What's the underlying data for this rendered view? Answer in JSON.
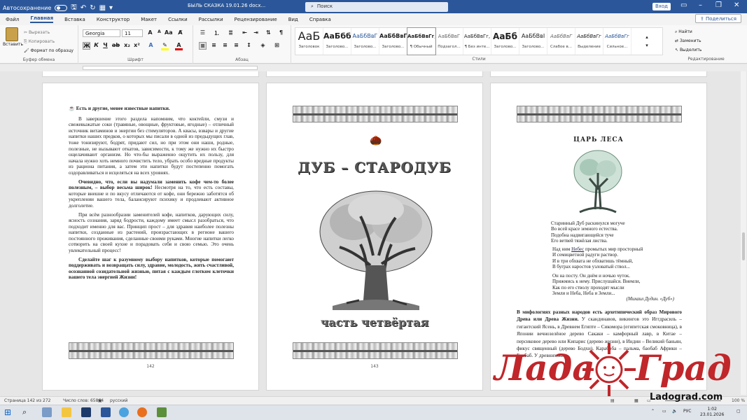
{
  "titlebar": {
    "autosave": "Автосохранение",
    "doc_title": "БЫЛЬ СКАЗКА 19.01.26 docx...",
    "search": "Поиск",
    "signin": "Вход"
  },
  "menu": [
    "Файл",
    "Главная",
    "Вставка",
    "Конструктор",
    "Макет",
    "Ссылки",
    "Рассылки",
    "Рецензирование",
    "Вид",
    "Справка"
  ],
  "share": "Поделиться",
  "ribbon": {
    "clipboard": {
      "paste": "Вставить",
      "cut": "Вырезать",
      "copy": "Копировать",
      "format": "Формат по образцу",
      "label": "Буфер обмена"
    },
    "font": {
      "name": "Georgia",
      "size": "11",
      "label": "Шрифт"
    },
    "paragraph_label": "Абзац",
    "styles": [
      {
        "preview": "АаБ",
        "name": "Заголовок"
      },
      {
        "preview": "АаБбб",
        "name": "Заголово..."
      },
      {
        "preview": "АаБбВвГ",
        "name": "Заголово..."
      },
      {
        "preview": "АаБбВвГ",
        "name": "Заголово..."
      },
      {
        "preview": "АаБбВвГг,",
        "name": "¶ Обычный"
      },
      {
        "preview": "АаБбВвГ",
        "name": "Подзагол..."
      },
      {
        "preview": "АаБбВвГг,",
        "name": "¶ Без инте..."
      },
      {
        "preview": "АаБб",
        "name": "Заголово..."
      },
      {
        "preview": "АаБбВвІ",
        "name": "Заголово..."
      },
      {
        "preview": "АаБбВвГ",
        "name": "Слабое в..."
      },
      {
        "preview": "АаБбВвГг",
        "name": "Выделение"
      },
      {
        "preview": "АаБбВвГг",
        "name": "Сильное..."
      }
    ],
    "styles_label": "Стили",
    "editing": {
      "find": "Найти",
      "replace": "Заменить",
      "select": "Выделить",
      "label": "Редактирование"
    }
  },
  "page1": {
    "heading": "Есть и другие, менее известные напитки.",
    "p1": "В завершение этого раздела напомним, что коктейли, смузи и свежевыжатые соки (травяные, овощные, фруктовые, ягодные) – отличный источник витаминов и энергии без стимуляторов. А квасы, взвары и другие напитки наших предков, о которых мы писали в одной из предыдущих глав, тоже тонизируют, бодрят, придают сил, но при этом они наши, родные, полезные, не вызывают откатов, зависимости, к тому же нужно их быстро ощелачивают организм. Но что-бы выраженно ощутить их пользу, для начала нужно хоть немного почистить тело, убрать особо вредные продукты из рациона питания, а затем эти напитки будут постепенно помогать оздоравливаться и исцеляться на всех уровнях.",
    "p2_bold": "Очевидно, что, если вы надумали заменить кофе чем-то более полезным, – выбор весьма широк!",
    "p2": " Несмотря на то, что есть составы, которые внешне и по вкусу отличаются от кофе, они бережно заботятся об укреплении вашего тела, балансируют психику и продлевают активное долголетие.",
    "p3": "При всём разнообразии заменителей кофе, напитков, дарующих силу, ясность сознания, заряд бодрости, каждому имеет смысл разобраться, что подходит именно для вас. Принцип прост – для здравия наиболее полезны напитки, созданные из растений, произрастающих в регионе вашего постоянного проживания, сделанные своими руками. Многие напитки легко сотворить на своей кухне и порадовать себя и свою семью. Это очень увлекательный процесс!",
    "p4_bold": "Сделайте шаг к разумному выбору напитков, которые помогают поддерживать и возвращать силу, здравие, молодость, жить счастливой, осознанной созидательной жизнью, питая с каждым глотком клеточки вашего тела энергией Жизни!",
    "number": "142"
  },
  "page2": {
    "title": "ДУБ – СТАРОДУБ",
    "subtitle": "часть четвёртая",
    "number": "143"
  },
  "page3": {
    "heading": "ЦАРЬ ЛЕСА",
    "stanza1": [
      "Старинный Дуб раскинулся могуче",
      "Во всей красе земного естества.",
      "Подобна надвигающейся туче",
      "Его ветвей тяжёлая листва."
    ],
    "stanza2_line1_a": "Над ним ",
    "stanza2_line1_link": "Небес",
    "stanza2_line1_b": " промытых мир просторный",
    "stanza2": [
      "И семицветной радуги раствор.",
      "И в три обхвата не обхватишь тёмный,",
      "В буграх наростов узловатый ствол..."
    ],
    "stanza3": [
      "Он на посту. Он днём и ночью чуток.",
      "Прижмись к нему. Прислушайся. Внемли,",
      "Как по его стволу проходят мысли",
      "Земли и Неба, Неба и Земли..."
    ],
    "author": "(Михаил Дудин. «Дуб»)",
    "text_bold": "В мифологиях разных народов есть архетипический образ Мирового Древа или Древа Жизни.",
    "text": " У скандинавов, викингов это Иггдрасиль – гигантский Ясень, в Древнем Египте – Сикомора (египетская смоковница), в Японии вечнозелёное дерево Сакаки – камфорный лавр, в Китае – персиковое дерево или Кипарис (дерево жизни), в Индии – Великий баньян, фикус священный (дерево Бодхи), Карабоба – пальма, баобаб Африки – Баобаб. У древних же"
  },
  "watermark": {
    "text_left": "Лада",
    "text_right": "Град",
    "site": "Ladograd.com"
  },
  "status": {
    "page": "Страница 142 из 272",
    "words": "Число слов: 65864",
    "lang": "русский",
    "zoom": "100 %"
  },
  "taskbar": {
    "lang": "РУС",
    "time": "1:02",
    "date": "23.01.2026"
  }
}
